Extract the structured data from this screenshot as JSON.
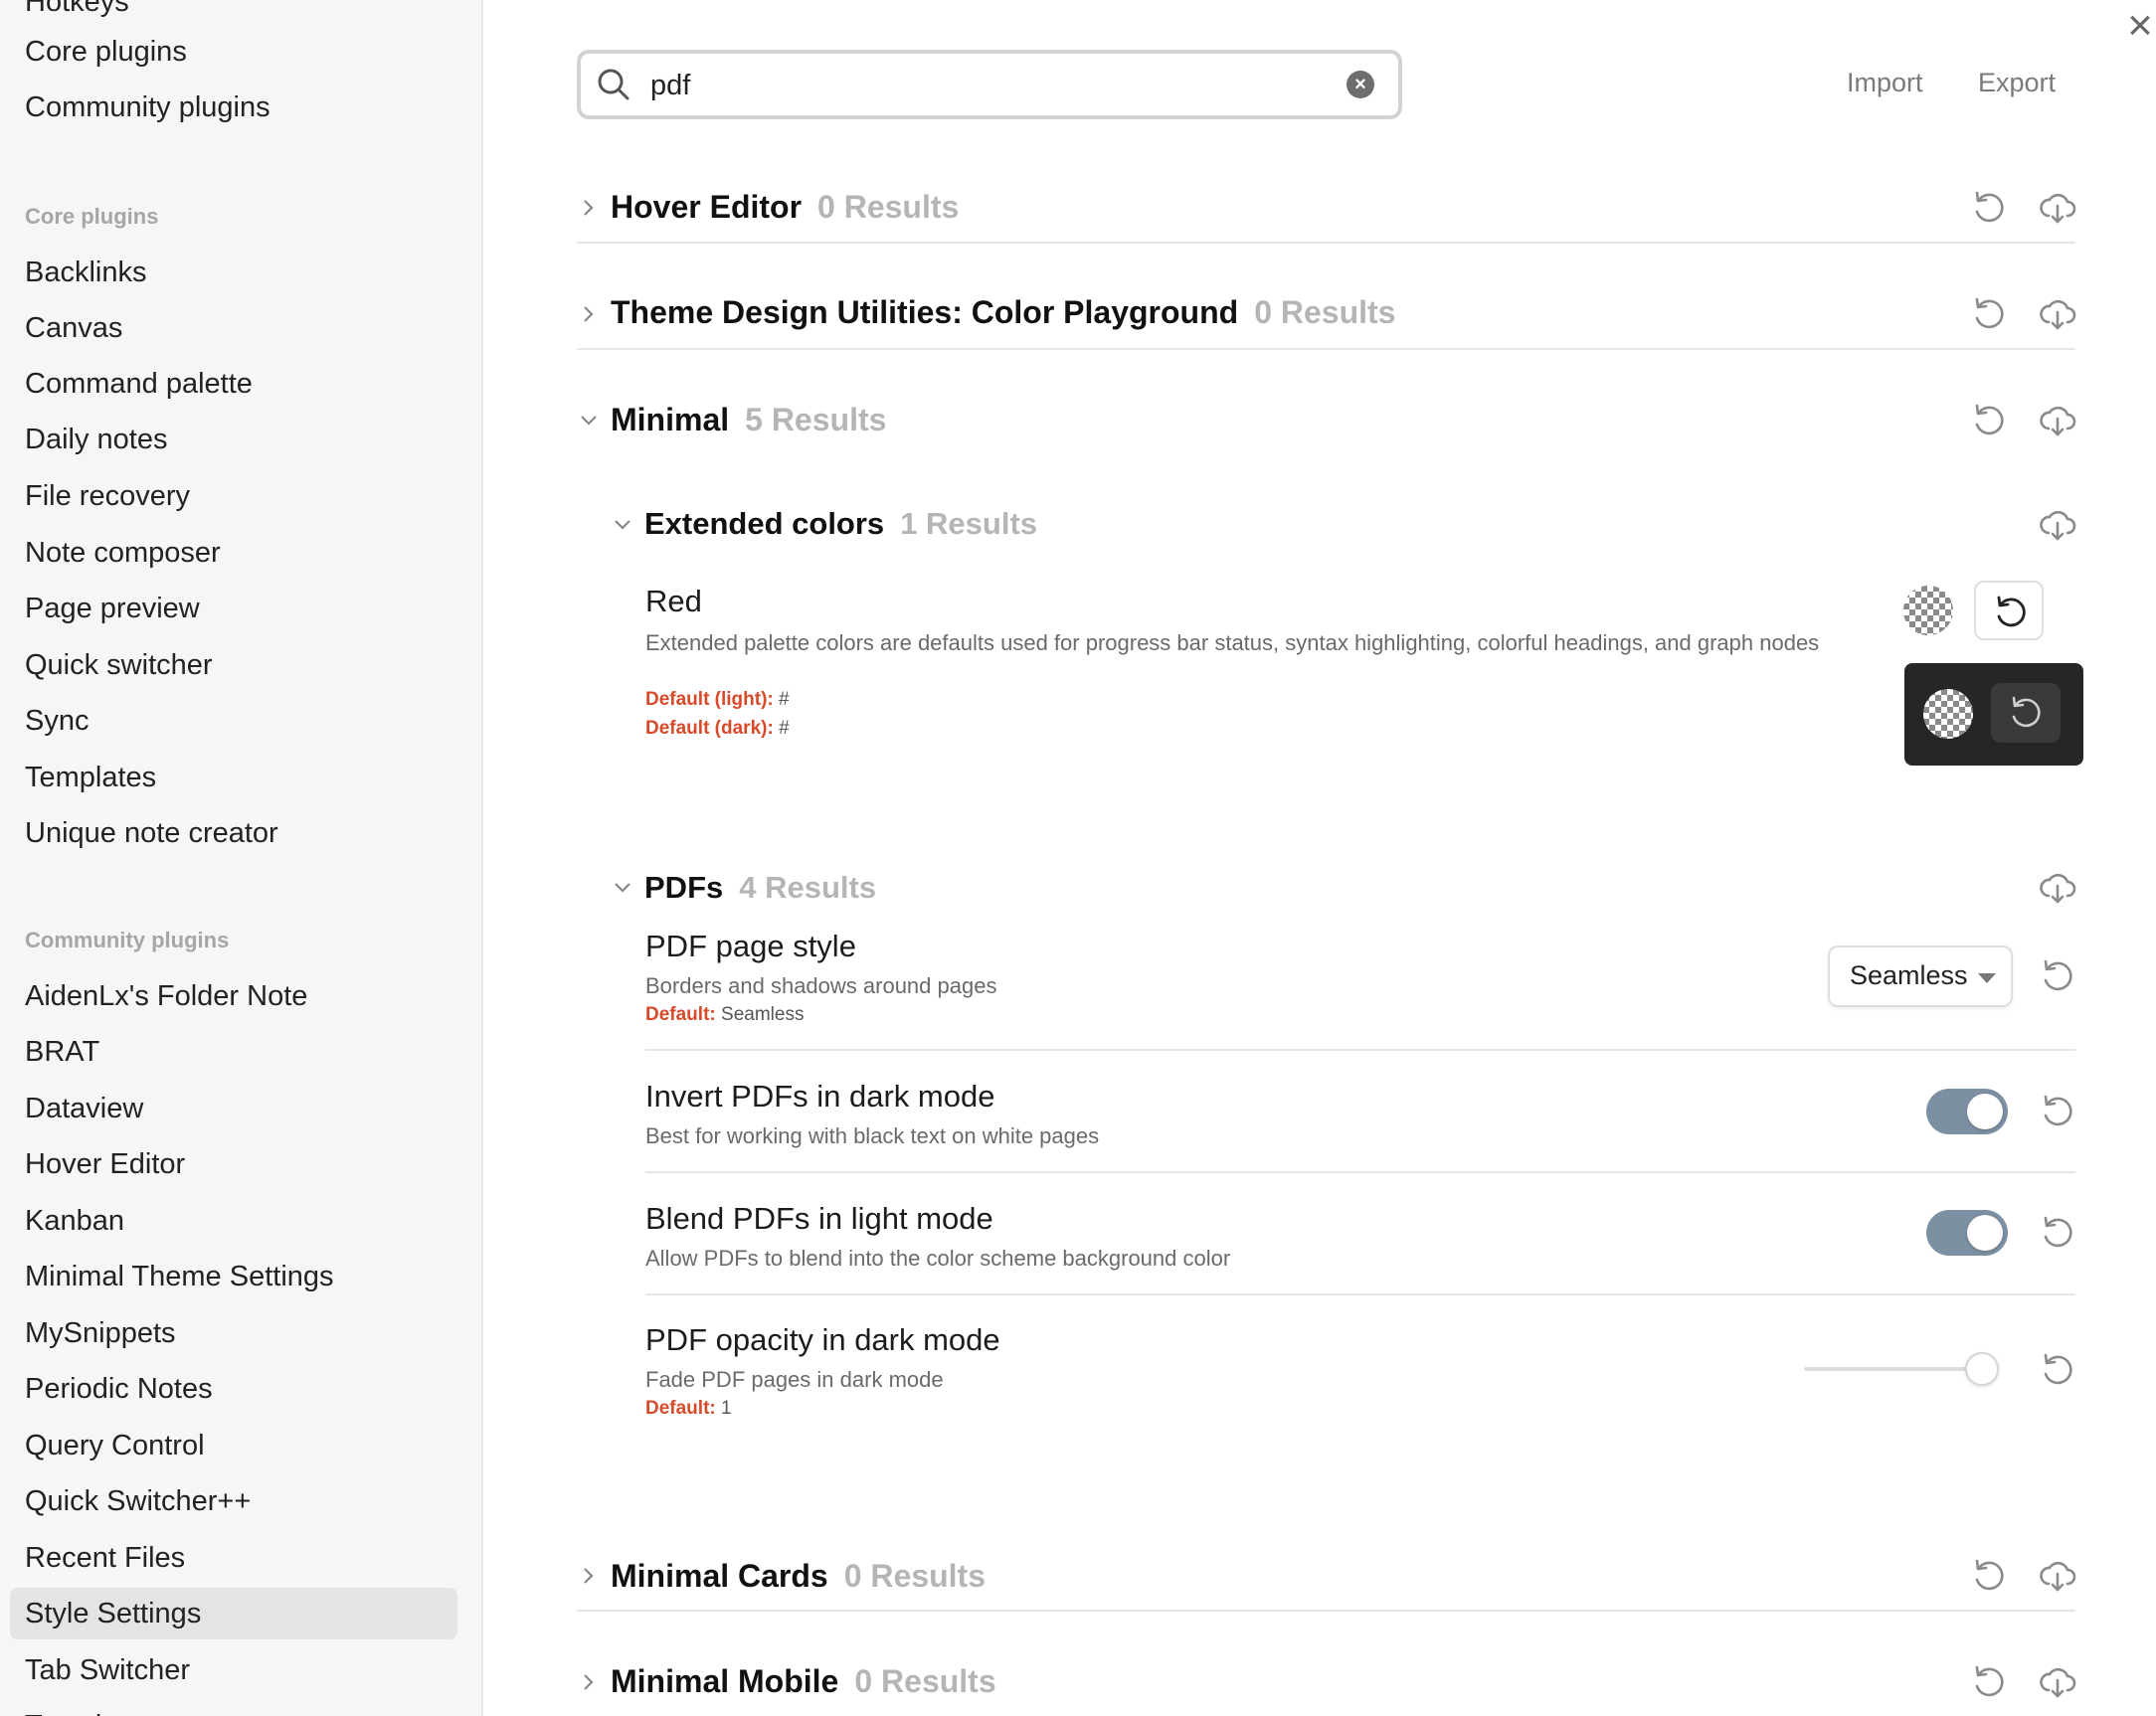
{
  "sidebar": {
    "top_items": [
      {
        "label": "Hotkeys"
      },
      {
        "label": "Core plugins"
      },
      {
        "label": "Community plugins"
      }
    ],
    "core_header": "Core plugins",
    "core_items": [
      {
        "label": "Backlinks"
      },
      {
        "label": "Canvas"
      },
      {
        "label": "Command palette"
      },
      {
        "label": "Daily notes"
      },
      {
        "label": "File recovery"
      },
      {
        "label": "Note composer"
      },
      {
        "label": "Page preview"
      },
      {
        "label": "Quick switcher"
      },
      {
        "label": "Sync"
      },
      {
        "label": "Templates"
      },
      {
        "label": "Unique note creator"
      }
    ],
    "community_header": "Community plugins",
    "community_items": [
      {
        "label": "AidenLx's Folder Note"
      },
      {
        "label": "BRAT"
      },
      {
        "label": "Dataview"
      },
      {
        "label": "Hover Editor"
      },
      {
        "label": "Kanban"
      },
      {
        "label": "Minimal Theme Settings"
      },
      {
        "label": "MySnippets"
      },
      {
        "label": "Periodic Notes"
      },
      {
        "label": "Query Control"
      },
      {
        "label": "Quick Switcher++"
      },
      {
        "label": "Recent Files"
      },
      {
        "label": "Style Settings"
      },
      {
        "label": "Tab Switcher"
      },
      {
        "label": "Templater"
      }
    ],
    "active_item": "Style Settings"
  },
  "toolbar": {
    "search_value": "pdf",
    "import_label": "Import",
    "export_label": "Export",
    "close_glyph": "×"
  },
  "groups": [
    {
      "title": "Hover Editor",
      "count": "0 Results"
    },
    {
      "title": "Theme Design Utilities: Color Playground",
      "count": "0 Results"
    },
    {
      "title": "Minimal",
      "count": "5 Results"
    },
    {
      "title": "Minimal Cards",
      "count": "0 Results"
    },
    {
      "title": "Minimal Mobile",
      "count": "0 Results"
    }
  ],
  "subgroups": [
    {
      "title": "Extended colors",
      "count": "1 Results"
    },
    {
      "title": "PDFs",
      "count": "4 Results"
    }
  ],
  "settings": {
    "red": {
      "title": "Red",
      "description": "Extended palette colors are defaults used for progress bar status, syntax highlighting, colorful headings, and graph nodes",
      "default_light_label": "Default (light):",
      "default_light_value": "#",
      "default_dark_label": "Default (dark):",
      "default_dark_value": "#"
    },
    "pdf_page_style": {
      "title": "PDF page style",
      "description": "Borders and shadows around pages",
      "default_label": "Default:",
      "default_value": "Seamless",
      "selected": "Seamless"
    },
    "invert_pdfs": {
      "title": "Invert PDFs in dark mode",
      "description": "Best for working with black text on white pages",
      "enabled": true
    },
    "blend_pdfs": {
      "title": "Blend PDFs in light mode",
      "description": "Allow PDFs to blend into the color scheme background color",
      "enabled": true
    },
    "pdf_opacity": {
      "title": "PDF opacity in dark mode",
      "description": "Fade PDF pages in dark mode",
      "default_label": "Default:",
      "default_value": "1",
      "slider_fraction": 0.95
    }
  },
  "colors": {
    "accent_toggle": "#7d8fa3",
    "default_label": "#d94a2b",
    "count_text": "#b5b5b5"
  }
}
